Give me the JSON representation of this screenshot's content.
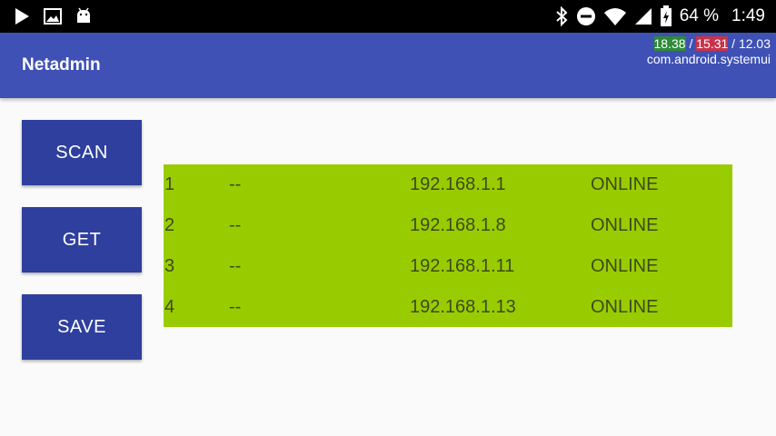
{
  "status_bar": {
    "icons": [
      "play-store-icon",
      "image-icon",
      "android-icon",
      "bluetooth-icon",
      "do-not-disturb-icon",
      "wifi-icon",
      "cellular-signal-icon",
      "battery-charging-icon"
    ],
    "battery": "64 %",
    "time": "1:49"
  },
  "app_bar": {
    "title": "Netadmin",
    "overlay_load_1": "18.38",
    "overlay_sep_1": " / ",
    "overlay_load_2": "15.31",
    "overlay_sep_2": " / ",
    "overlay_load_3": "12.03",
    "overlay_process": "com.android.systemui"
  },
  "buttons": {
    "scan": "SCAN",
    "get": "GET",
    "save": "SAVE"
  },
  "results": [
    {
      "id": "1",
      "name": "--",
      "ip": "192.168.1.1",
      "status": "ONLINE"
    },
    {
      "id": "2",
      "name": "--",
      "ip": "192.168.1.8",
      "status": "ONLINE"
    },
    {
      "id": "3",
      "name": "--",
      "ip": "192.168.1.11",
      "status": "ONLINE"
    },
    {
      "id": "4",
      "name": "--",
      "ip": "192.168.1.13",
      "status": "ONLINE"
    }
  ],
  "colors": {
    "status_bar": "#000000",
    "app_bar": "#3f51b5",
    "button": "#2f3f9e",
    "results_background": "#99cc00",
    "page_background": "#fafafa"
  }
}
